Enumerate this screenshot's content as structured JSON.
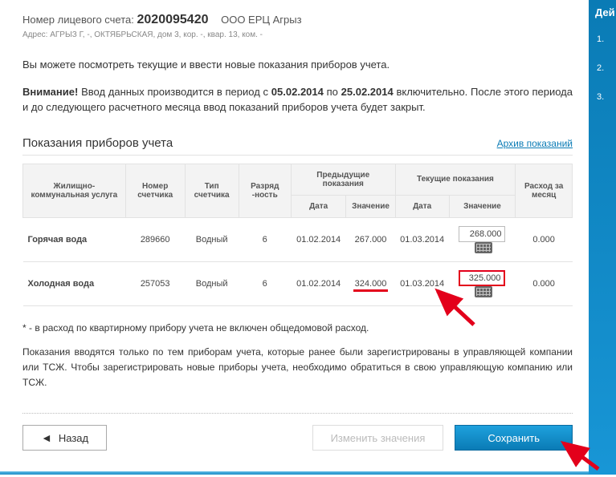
{
  "account": {
    "label": "Номер лицевого счета:",
    "number": "2020095420",
    "org": "ООО ЕРЦ Агрыз",
    "address_label": "Адрес:",
    "address": "АГРЫЗ Г, -, ОКТЯБРЬСКАЯ, дом 3, кор. -, квар. 13, ком. -"
  },
  "intro": "Вы можете посмотреть текущие и ввести новые показания приборов учета.",
  "warning_label": "Внимание!",
  "warning_part1": "Ввод данных производится в период с",
  "warning_date_from": "05.02.2014",
  "warning_part2": "по",
  "warning_date_to": "25.02.2014",
  "warning_part3": "включительно. После этого периода и до следующего расчетного месяца ввод показаний приборов учета будет закрыт.",
  "section_title": "Показания приборов учета",
  "archive_link": "Архив показаний",
  "headers": {
    "service": "Жилищно-коммунальная услуга",
    "meter_no": "Номер счетчика",
    "meter_type": "Тип счетчика",
    "digits": "Разряд -ность",
    "prev_group": "Предыдущие показания",
    "curr_group": "Текущие показания",
    "date": "Дата",
    "value": "Значение",
    "usage": "Расход за месяц"
  },
  "rows": [
    {
      "service": "Горячая вода",
      "meter_no": "289660",
      "meter_type": "Водный",
      "digits": "6",
      "prev_date": "01.02.2014",
      "prev_value": "267.000",
      "curr_date": "01.03.2014",
      "curr_value": "268.000",
      "usage": "0.000",
      "highlight": false
    },
    {
      "service": "Холодная вода",
      "meter_no": "257053",
      "meter_type": "Водный",
      "digits": "6",
      "prev_date": "01.02.2014",
      "prev_value": "324.000",
      "curr_date": "01.03.2014",
      "curr_value": "325.000",
      "usage": "0.000",
      "highlight": true
    }
  ],
  "footnote": "* - в расход по квартирному прибору учета не включен общедомовой расход.",
  "info": "Показания вводятся только по тем приборам учета, которые ранее были зарегистрированы в управляющей компании или ТСЖ. Чтобы зарегистрировать новые приборы учета, необходимо обратиться в свою управляющую компанию или ТСЖ.",
  "buttons": {
    "back": "Назад",
    "edit": "Изменить значения",
    "save": "Сохранить"
  },
  "sidebar": {
    "title": "Дей",
    "items": [
      "1.",
      "2.",
      "3."
    ]
  }
}
